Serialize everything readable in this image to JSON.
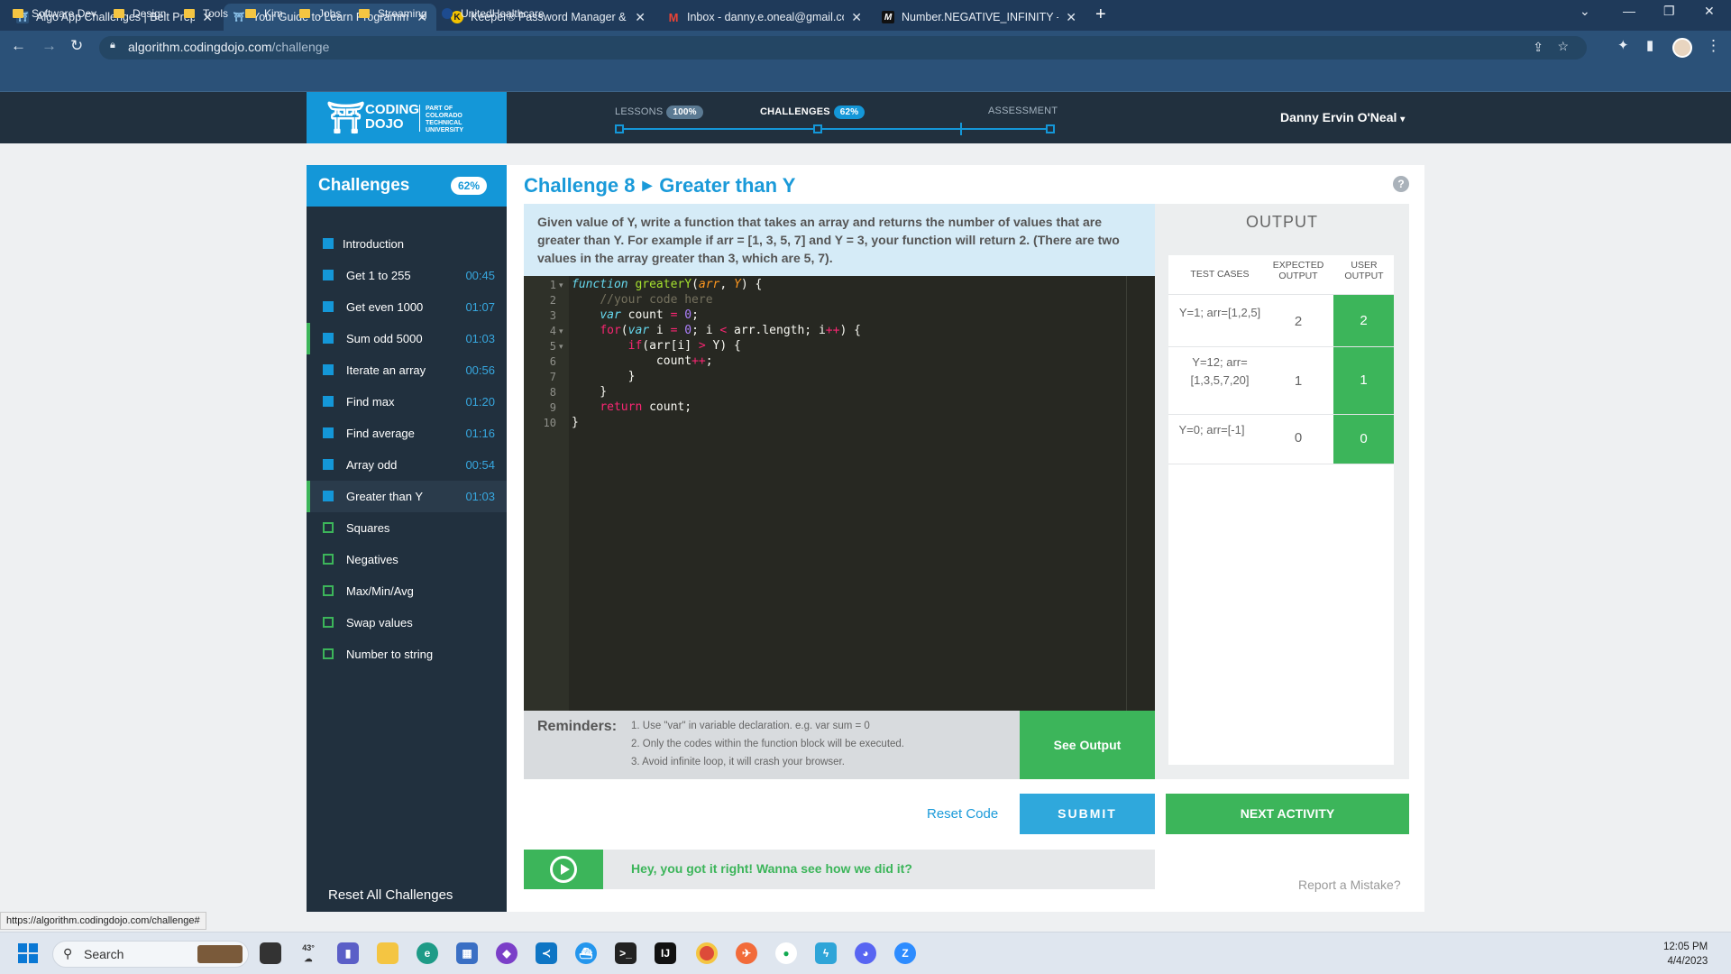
{
  "browser": {
    "tabs": [
      {
        "title": "Algo App Challenges | Belt Prep",
        "active": false
      },
      {
        "title": "Your Guide to Learn Programmin",
        "active": true
      },
      {
        "title": "Keeper® Password Manager & D",
        "active": false
      },
      {
        "title": "Inbox - danny.e.oneal@gmail.com",
        "active": false
      },
      {
        "title": "Number.NEGATIVE_INFINITY - Ja",
        "active": false
      }
    ],
    "url_host": "algorithm.codingdojo.com",
    "url_path": "/challenge",
    "bookmarks": [
      "Software Dev",
      "Design",
      "Tools",
      "Kim",
      "Jobs",
      "Streaming",
      "UnitedHealthcare"
    ],
    "status_url": "https://algorithm.codingdojo.com/challenge#"
  },
  "header": {
    "logo_text": "CODING DOJO",
    "logo_sub": "PART OF COLORADO TECHNICAL UNIVERSITY",
    "lessons_label": "LESSONS",
    "lessons_badge": "100%",
    "challenges_label": "CHALLENGES",
    "challenges_badge": "62%",
    "assessment_label": "ASSESSMENT",
    "user_name": "Danny Ervin O'Neal"
  },
  "sidebar": {
    "title": "Challenges",
    "badge": "62%",
    "items": [
      {
        "name": "Introduction",
        "time": "",
        "done": true
      },
      {
        "name": "Get 1 to 255",
        "time": "00:45",
        "done": true
      },
      {
        "name": "Get even 1000",
        "time": "01:07",
        "done": true
      },
      {
        "name": "Sum odd 5000",
        "time": "01:03",
        "done": true
      },
      {
        "name": "Iterate an array",
        "time": "00:56",
        "done": true
      },
      {
        "name": "Find max",
        "time": "01:20",
        "done": true
      },
      {
        "name": "Find average",
        "time": "01:16",
        "done": true
      },
      {
        "name": "Array odd",
        "time": "00:54",
        "done": true
      },
      {
        "name": "Greater than Y",
        "time": "01:03",
        "done": true
      },
      {
        "name": "Squares",
        "time": "",
        "done": false
      },
      {
        "name": "Negatives",
        "time": "",
        "done": false
      },
      {
        "name": "Max/Min/Avg",
        "time": "",
        "done": false
      },
      {
        "name": "Swap values",
        "time": "",
        "done": false
      },
      {
        "name": "Number to string",
        "time": "",
        "done": false
      }
    ],
    "reset_all": "Reset All Challenges"
  },
  "challenge": {
    "number": "Challenge 8",
    "name": "Greater than Y",
    "description": "Given value of Y, write a function that takes an array and returns the number of values that are greater than Y. For example if arr = [1, 3, 5, 7] and Y = 3, your function will return 2. (There are two values in the array greater than 3, which are 5, 7).",
    "line_numbers": [
      "1",
      "2",
      "3",
      "4",
      "5",
      "6",
      "7",
      "8",
      "9",
      "10"
    ],
    "reminders_title": "Reminders:",
    "reminders": [
      "1. Use \"var\" in variable declaration. e.g. var sum = 0",
      "2. Only the codes within the function block will be executed.",
      "3. Avoid infinite loop, it will crash your browser."
    ],
    "see_output": "See Output",
    "reset_code": "Reset Code",
    "submit": "SUBMIT",
    "next_activity": "NEXT ACTIVITY",
    "hint": "Hey, you got it right! Wanna see how we did it?",
    "report": "Report a Mistake?"
  },
  "output": {
    "title": "OUTPUT",
    "col_test": "TEST CASES",
    "col_expected": "EXPECTED OUTPUT",
    "col_user": "USER OUTPUT",
    "rows": [
      {
        "case": "Y=1; arr=[1,2,5]",
        "expected": "2",
        "user": "2"
      },
      {
        "case": "Y=12; arr= [1,3,5,7,20]",
        "expected": "1",
        "user": "1"
      },
      {
        "case": "Y=0; arr=[-1]",
        "expected": "0",
        "user": "0"
      }
    ],
    "pass_color": "#3cb55a"
  },
  "taskbar": {
    "search": "Search",
    "weather": "43°",
    "time": "12:05 PM",
    "date": "4/4/2023"
  }
}
